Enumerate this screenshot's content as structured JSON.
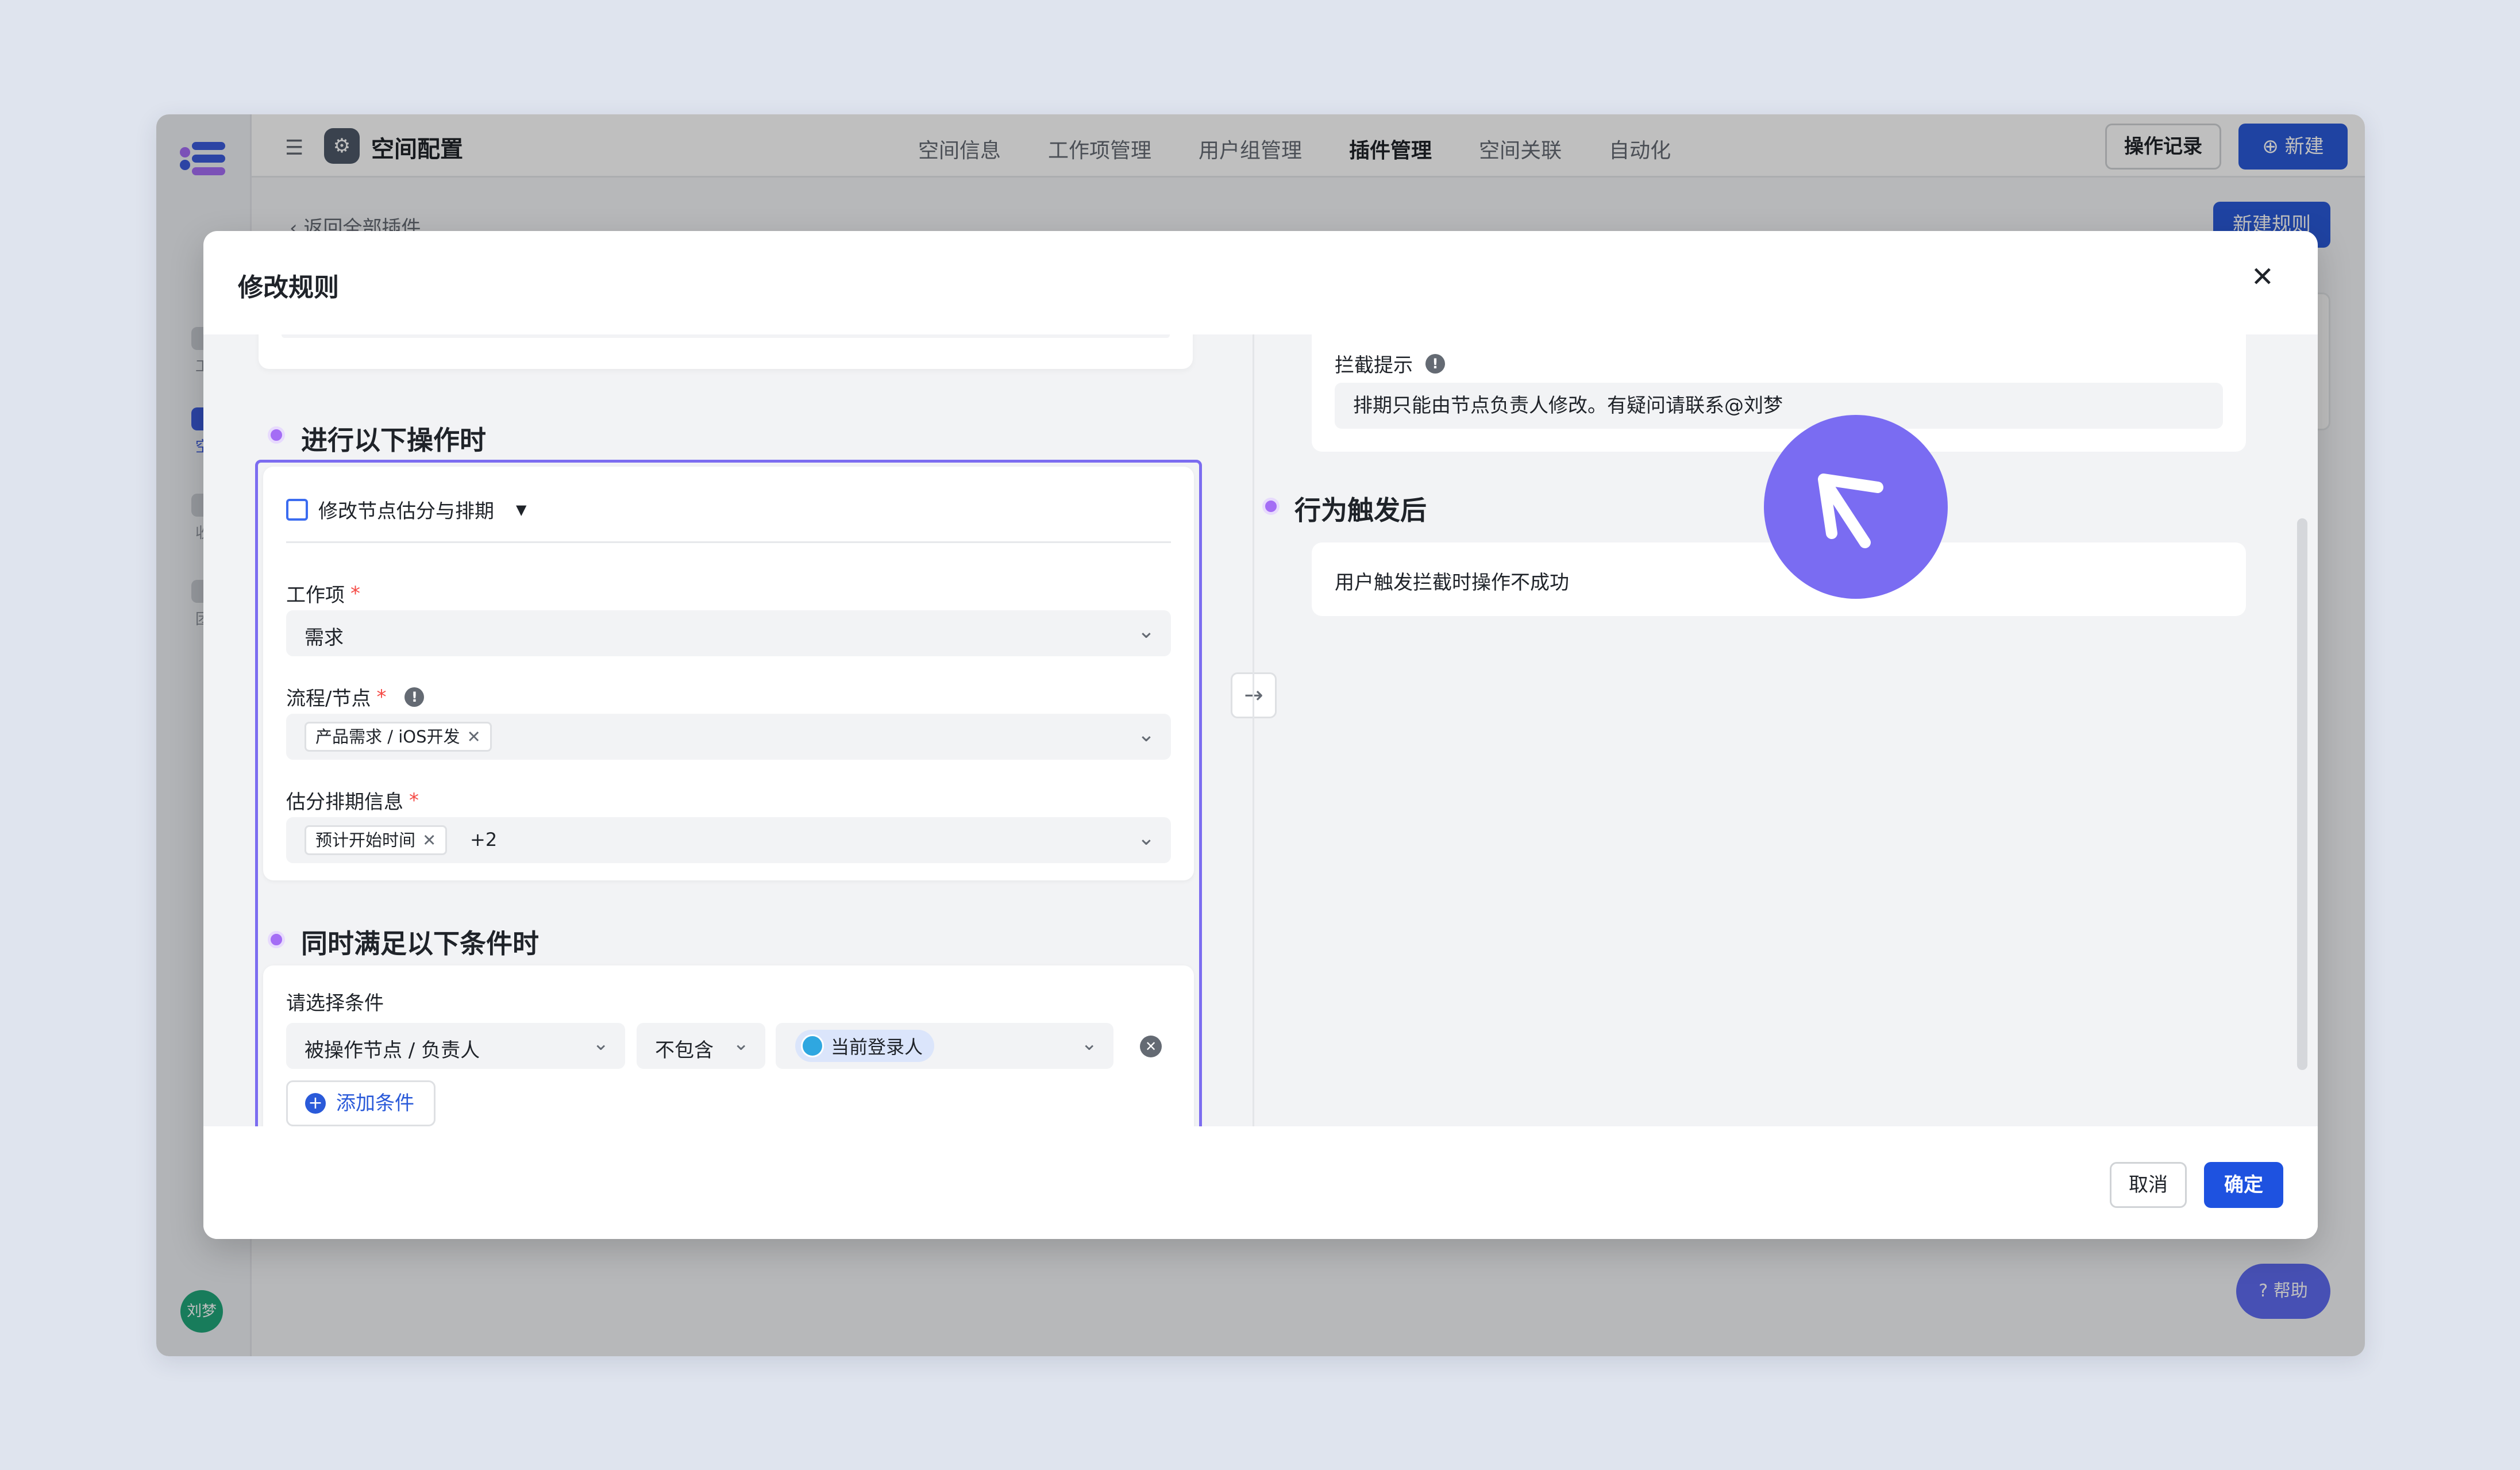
{
  "app": {
    "space_title": "空间配置",
    "nav": [
      "空间信息",
      "工作项管理",
      "用户组管理",
      "插件管理",
      "空间关联",
      "自动化"
    ],
    "nav_active_index": 3,
    "log_button": "操作记录",
    "new_button": "新建",
    "back_link": "返回全部插件",
    "new_rule_button": "新建规则",
    "sidebar_items": [
      "工",
      "空",
      "收",
      "团"
    ],
    "user_avatar": "刘梦",
    "help_label": "帮助"
  },
  "modal": {
    "title": "修改规则",
    "close_icon": "close-icon",
    "left": {
      "trigger_title": "进行以下操作时",
      "action": {
        "name": "修改节点估分与排期",
        "fields": {
          "work_item": {
            "label": "工作项",
            "value": "需求"
          },
          "flow_node": {
            "label": "流程/节点",
            "tag": "产品需求 / iOS开发"
          },
          "estimate": {
            "label": "估分排期信息",
            "tag": "预计开始时间",
            "more": "+2"
          }
        }
      },
      "condition_title": "同时满足以下条件时",
      "condition": {
        "label": "请选择条件",
        "field": "被操作节点 / 负责人",
        "operator": "不包含",
        "value": "当前登录人",
        "add_label": "添加条件"
      }
    },
    "right": {
      "intercept_label": "拦截提示",
      "intercept_text": "排期只能由节点负责人修改。有疑问请联系@刘梦",
      "behavior_title": "行为触发后",
      "behavior_text": "用户触发拦截时操作不成功"
    },
    "footer": {
      "cancel": "取消",
      "ok": "确定"
    }
  },
  "colors": {
    "primary": "#2a5ad9",
    "accent_purple": "#a46df5",
    "outline": "#7c6cf0",
    "cursor": "#7a6cf2"
  }
}
